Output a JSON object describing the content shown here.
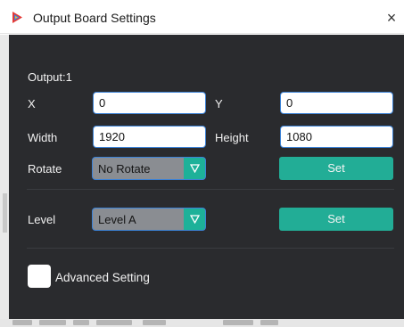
{
  "window": {
    "title": "Output Board Settings",
    "close_glyph": "×",
    "icon": "app-logo-icon"
  },
  "output_heading": "Output:1",
  "fields": {
    "x_label": "X",
    "x_value": "0",
    "y_label": "Y",
    "y_value": "0",
    "width_label": "Width",
    "width_value": "1920",
    "height_label": "Height",
    "height_value": "1080"
  },
  "rotate": {
    "label": "Rotate",
    "selected": "No Rotate",
    "set_label": "Set"
  },
  "level": {
    "label": "Level",
    "selected": "Level A",
    "set_label": "Set"
  },
  "advanced": {
    "label": "Advanced Setting",
    "checked": false
  },
  "colors": {
    "panel_bg": "#2a2b2e",
    "accent_teal": "#22ad96",
    "input_border": "#3c82d6",
    "combo_bg": "#8a8d92"
  }
}
